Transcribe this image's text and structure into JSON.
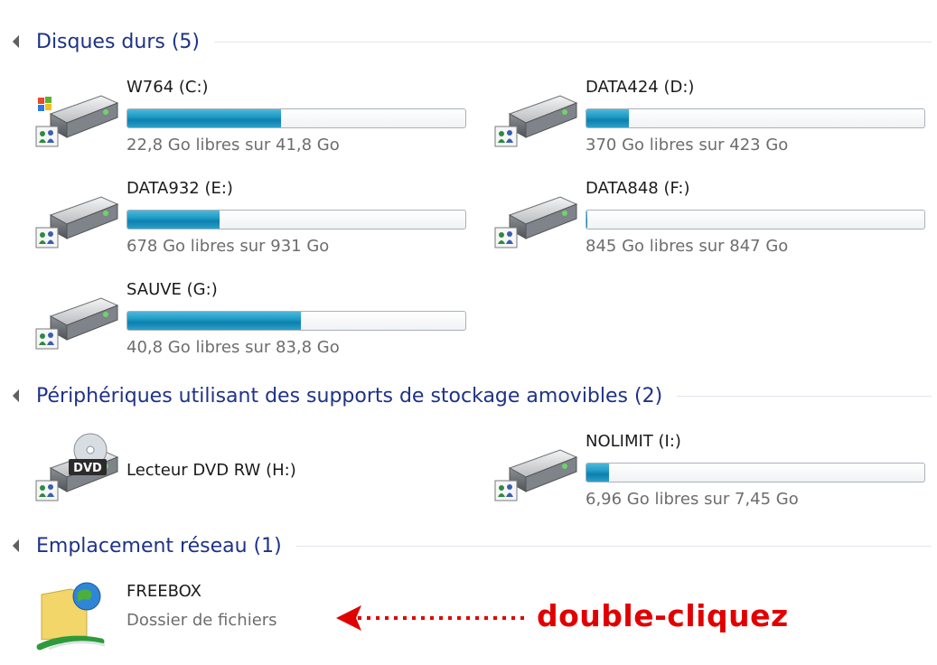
{
  "colors": {
    "group_title": "#1e3287",
    "bar_fill": "#1f9cc6",
    "annotation": "#e10000"
  },
  "groups": {
    "hard_disks": "Disques durs (5)",
    "removable": "Périphériques utilisant des supports de stockage amovibles (2)",
    "network": "Emplacement réseau (1)"
  },
  "drives": {
    "c": {
      "name": "W764 (C:)",
      "free": "22,8 Go libres sur 41,8 Go",
      "used_fraction": 0.455,
      "icon": "windows-hard-drive-icon"
    },
    "d": {
      "name": "DATA424 (D:)",
      "free": "370 Go libres sur 423 Go",
      "used_fraction": 0.125,
      "icon": "hard-drive-icon"
    },
    "e": {
      "name": "DATA932 (E:)",
      "free": "678 Go libres sur 931 Go",
      "used_fraction": 0.272,
      "icon": "hard-drive-icon"
    },
    "f": {
      "name": "DATA848 (F:)",
      "free": "845 Go libres sur 847 Go",
      "used_fraction": 0.002,
      "icon": "hard-drive-icon"
    },
    "g": {
      "name": "SAUVE (G:)",
      "free": "40,8 Go libres sur 83,8 Go",
      "used_fraction": 0.513,
      "icon": "hard-drive-icon"
    },
    "h": {
      "name": "Lecteur DVD RW (H:)",
      "icon": "dvd-drive-icon",
      "badge": "DVD"
    },
    "i": {
      "name": "NOLIMIT (I:)",
      "free": "6,96 Go libres sur 7,45 Go",
      "used_fraction": 0.066,
      "icon": "usb-drive-icon"
    }
  },
  "network": {
    "freebox": {
      "name": "FREEBOX",
      "type": "Dossier de fichiers",
      "icon": "network-folder-icon"
    }
  },
  "annotation": {
    "text": "double-cliquez"
  }
}
